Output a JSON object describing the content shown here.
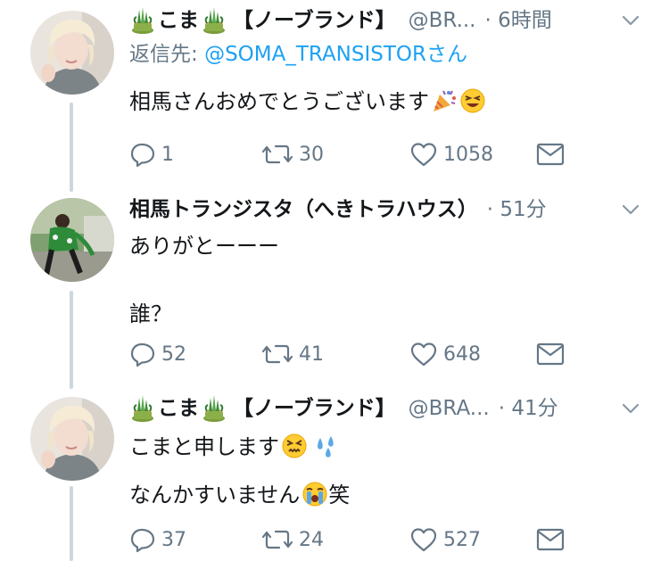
{
  "tweets": [
    {
      "name": "こま",
      "bracket": "【ノーブランド】",
      "handle": "@BR...",
      "time": "· 6時間",
      "reply_prefix": "返信先: ",
      "reply_to": "@SOMA_TRANSISTOR",
      "reply_suffix": "さん",
      "text": [
        "相馬さんおめでとうございます"
      ],
      "counts": {
        "reply": "1",
        "retweet": "30",
        "like": "1058"
      }
    },
    {
      "name": "相馬トランジスタ（へきトラハウス）",
      "time": "· 51分",
      "text": [
        "ありがとーーー",
        "誰？"
      ],
      "counts": {
        "reply": "52",
        "retweet": "41",
        "like": "648"
      }
    },
    {
      "name": "こま",
      "bracket": "【ノーブランド】",
      "handle": "@BRA...",
      "time": "· 41分",
      "text": [
        "こまと申します",
        "なんかすいません",
        "笑"
      ],
      "counts": {
        "reply": "37",
        "retweet": "24",
        "like": "527"
      }
    }
  ],
  "icons": {
    "reply": "speech-bubble-icon",
    "retweet": "retweet-arrows-icon",
    "like": "heart-outline-icon",
    "dm": "envelope-icon",
    "more": "chevron-down-icon"
  },
  "colors": {
    "link": "#1da1f2",
    "muted": "#657786",
    "thread": "#ccd6dd"
  }
}
